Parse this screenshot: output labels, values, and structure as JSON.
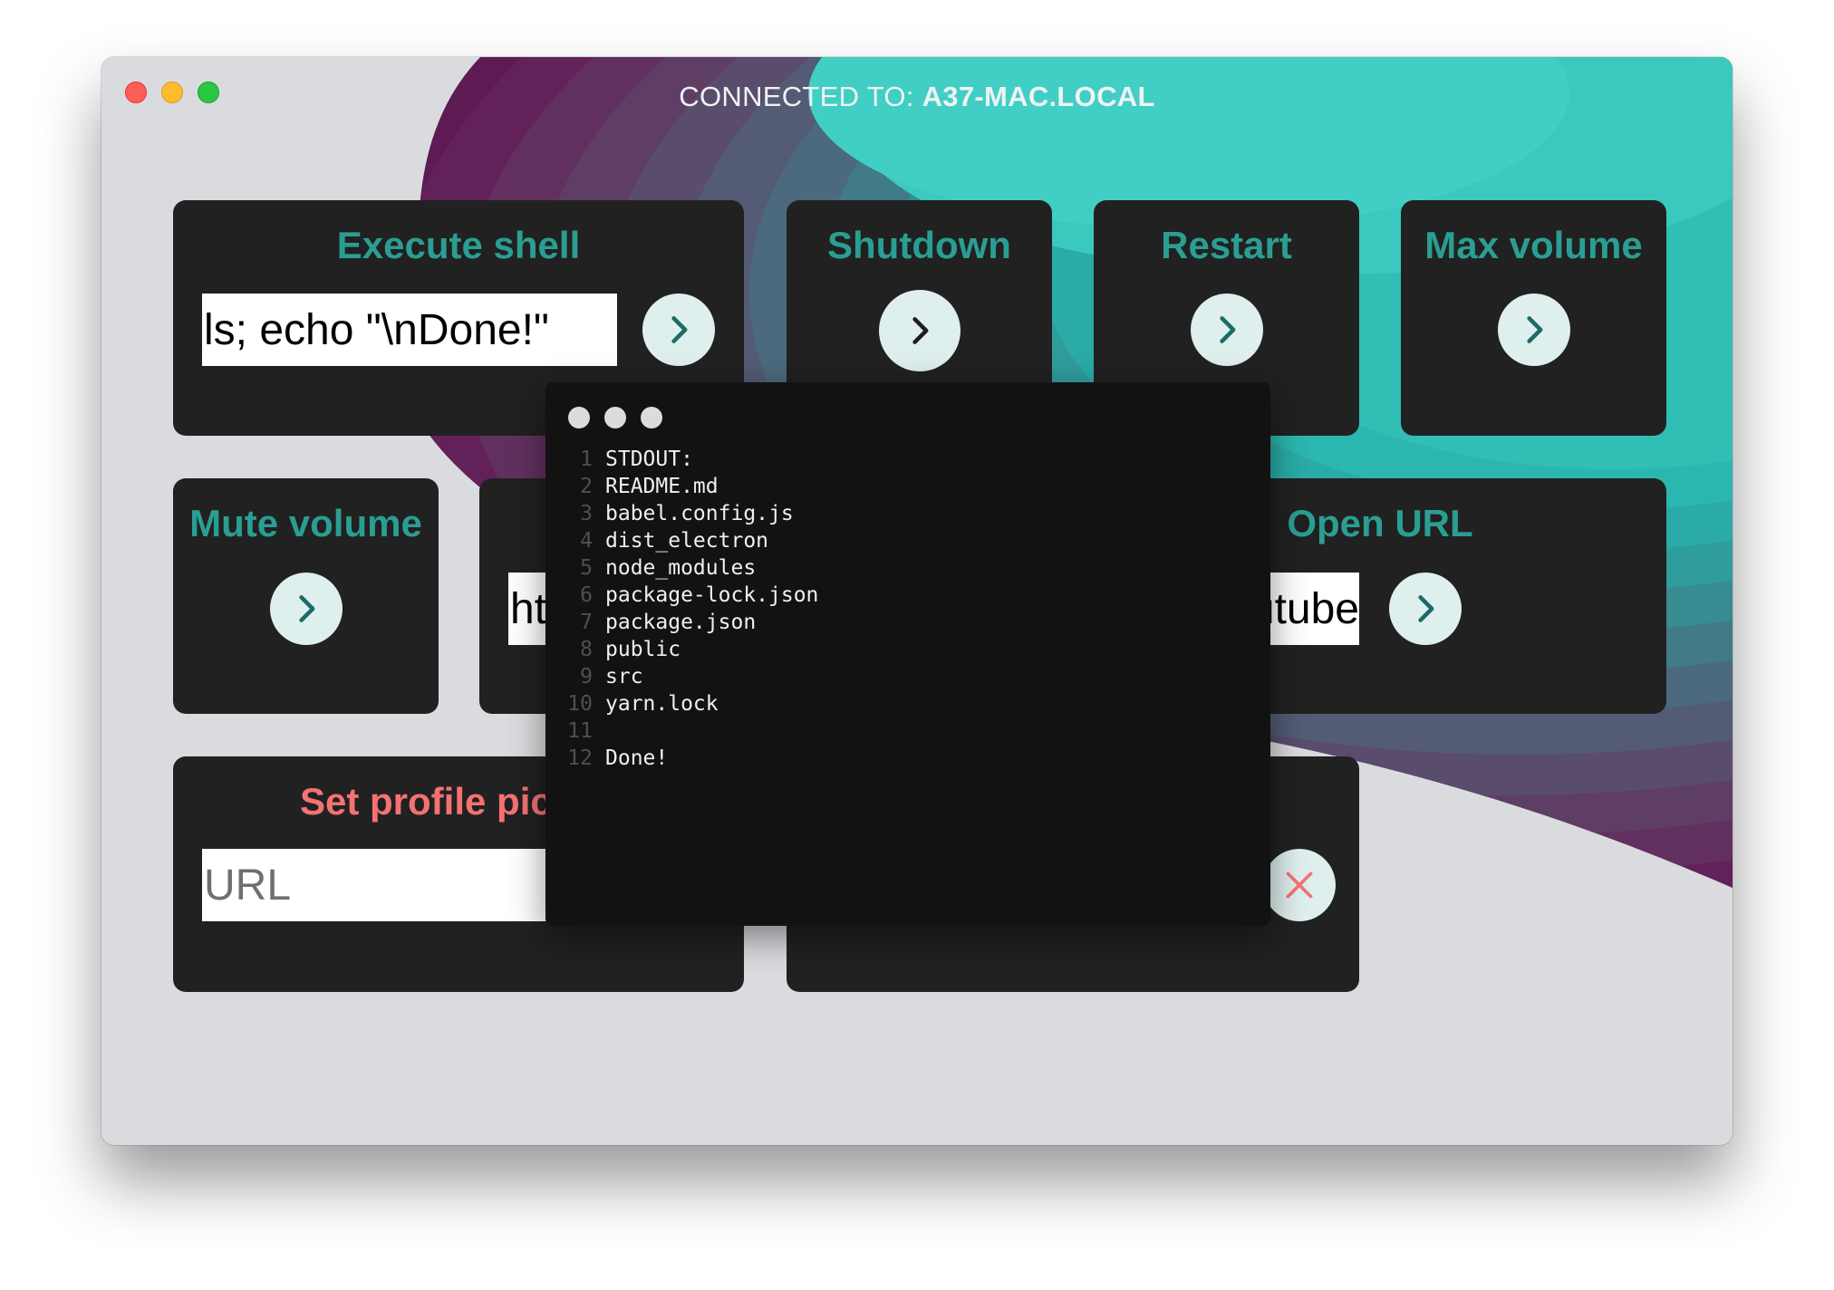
{
  "window": {
    "title_prefix": "CONNECTED TO:",
    "host": "A37-MAC.LOCAL"
  },
  "cards": {
    "execute_shell": {
      "title": "Execute shell",
      "input_value": "ls; echo \"\\nDone!\""
    },
    "shutdown": {
      "title": "Shutdown"
    },
    "restart": {
      "title": "Restart"
    },
    "max_volume": {
      "title": "Max volume"
    },
    "mute_volume": {
      "title": "Mute volume"
    },
    "hidden_card": {
      "input_value": "ht"
    },
    "open_url": {
      "title": "Open URL",
      "input_value": "www.youtube"
    },
    "profile_pic": {
      "title": "Set profile pic",
      "input_placeholder": "URL"
    }
  },
  "terminal": {
    "lines": [
      {
        "n": "1",
        "text": "STDOUT:"
      },
      {
        "n": "2",
        "text": "README.md"
      },
      {
        "n": "3",
        "text": "babel.config.js"
      },
      {
        "n": "4",
        "text": "dist_electron"
      },
      {
        "n": "5",
        "text": "node_modules"
      },
      {
        "n": "6",
        "text": "package-lock.json"
      },
      {
        "n": "7",
        "text": "package.json"
      },
      {
        "n": "8",
        "text": "public"
      },
      {
        "n": "9",
        "text": "src"
      },
      {
        "n": "10",
        "text": "yarn.lock"
      },
      {
        "n": "11",
        "text": ""
      },
      {
        "n": "12",
        "text": "Done!"
      }
    ]
  },
  "icons": {
    "go": "chevron-right-icon",
    "error": "x-icon"
  },
  "colors": {
    "accent_teal": "#2a9e92",
    "error_pink": "#f47272",
    "card_bg": "#212121",
    "window_bg": "#dadbde"
  }
}
